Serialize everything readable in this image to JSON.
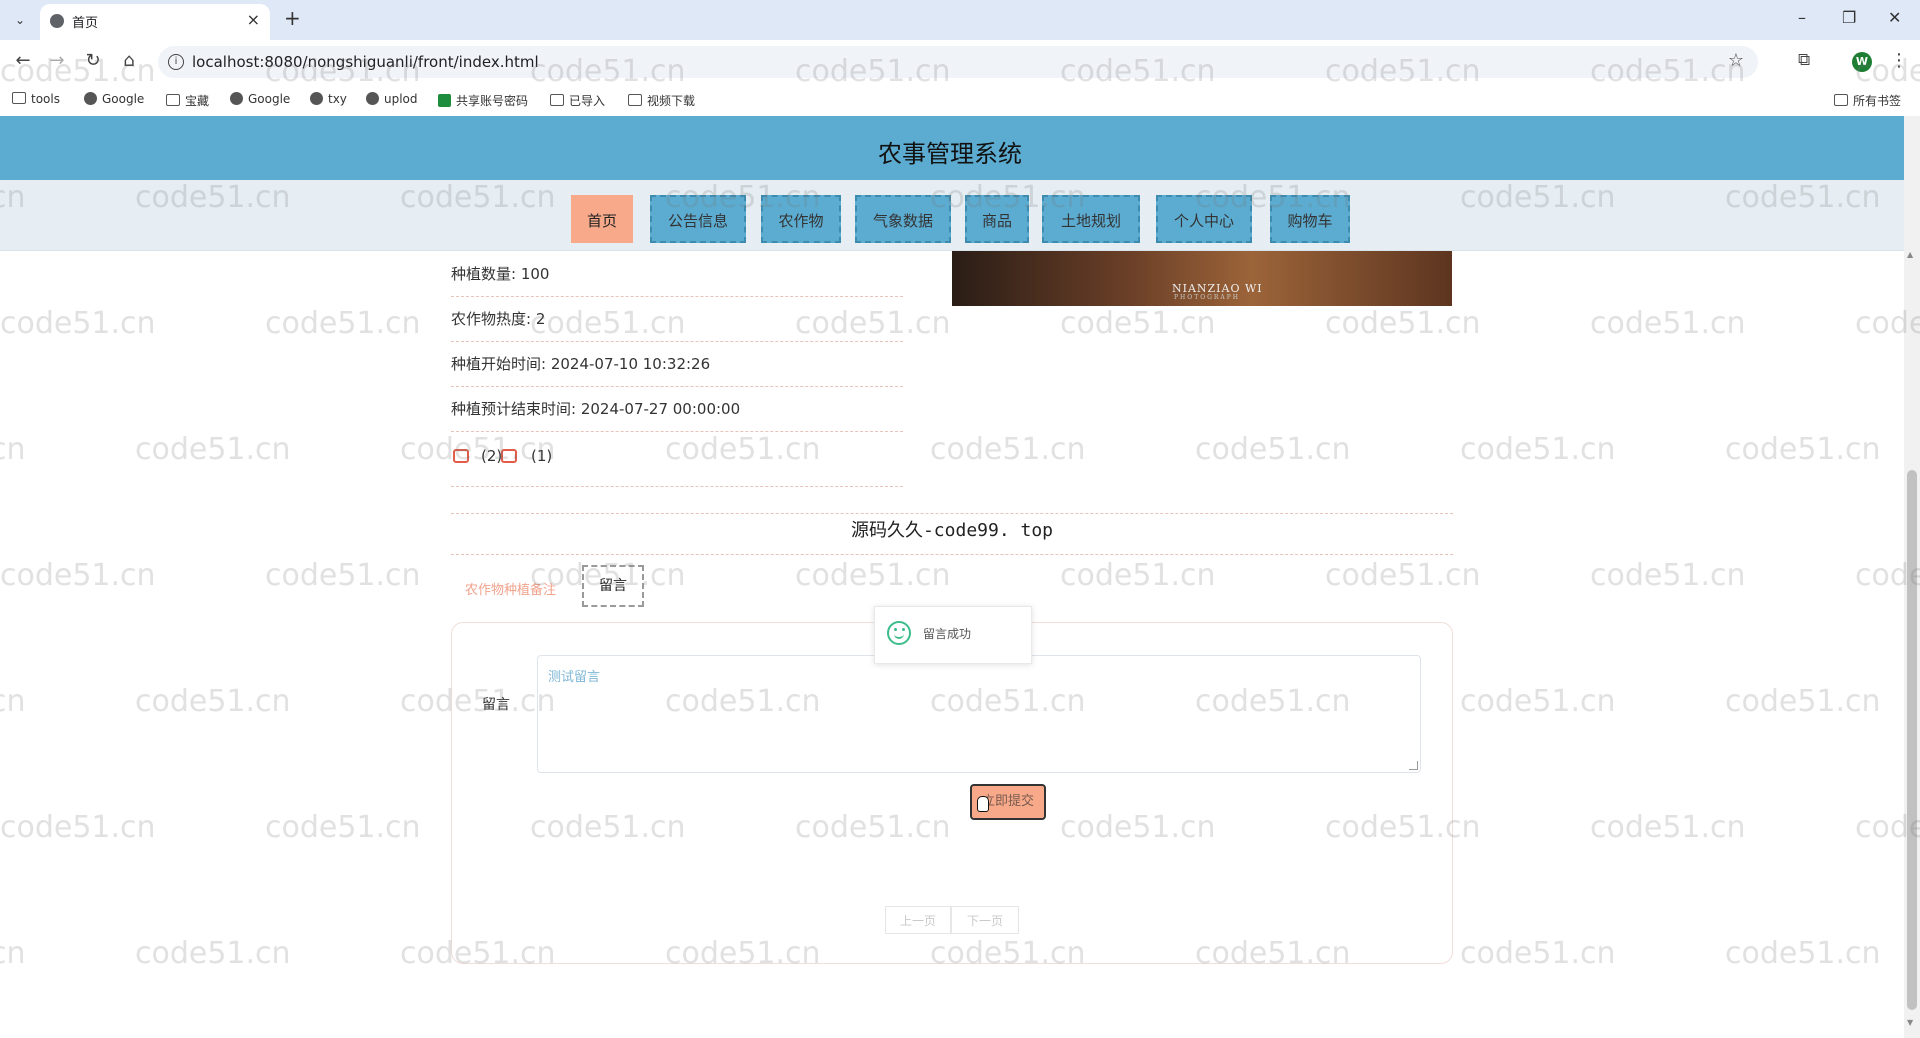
{
  "browser": {
    "tab_title": "首页",
    "url": "localhost:8080/nongshiguanli/front/index.html",
    "profile_initial": "W",
    "bookmarks": [
      "tools",
      "Google",
      "宝藏",
      "Google",
      "txy",
      "uplod",
      "共享账号密码",
      "已导入",
      "视频下载"
    ],
    "all_bookmarks": "所有书签",
    "icons": [
      "tab-search-icon",
      "close-icon",
      "new-tab-icon",
      "minimize-icon",
      "restore-icon",
      "close-window-icon",
      "back-icon",
      "forward-icon",
      "reload-icon",
      "home-icon",
      "site-info-icon",
      "star-icon",
      "extensions-icon",
      "kebab-menu-icon"
    ]
  },
  "site": {
    "title": "农事管理系统",
    "nav": [
      "首页",
      "公告信息",
      "农作物",
      "气象数据",
      "商品",
      "土地规划",
      "个人中心",
      "购物车"
    ],
    "active_nav": "首页"
  },
  "detail": {
    "planting_quantity": "种植数量: 100",
    "crop_heat": "农作物热度: 2",
    "start_time": "种植开始时间: 2024-07-10 10:32:26",
    "end_time": "种植预计结束时间: 2024-07-27 00:00:00",
    "likes": "(2)",
    "dislikes": "(1)",
    "image_mark": "NIANZIAO WI",
    "image_mark_sub": "PHOTOGRAPH"
  },
  "brand": "源码久久-code99. top",
  "tabs": {
    "detail_tab": "农作物种植备注",
    "message_tab": "留言"
  },
  "message_form": {
    "label": "留言",
    "value": "测试留言",
    "submit": "立即提交",
    "toast": "留言成功"
  },
  "pager": {
    "prev": "上一页",
    "next": "下一页"
  },
  "watermark": "code51.cn",
  "colors": {
    "header": "#5cacd1",
    "active_nav": "#f7a98a",
    "accent_text": "#f1a28b",
    "success": "#3bbd8b"
  }
}
